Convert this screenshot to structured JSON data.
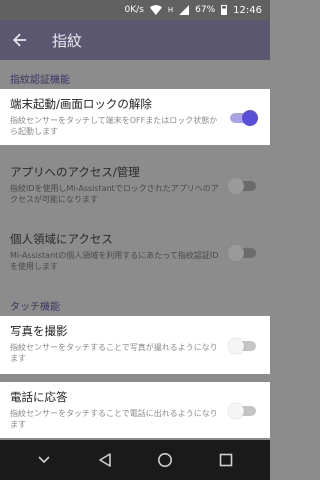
{
  "status_bar": {
    "speed": "0K/s",
    "signal_label": "H",
    "battery": "67%",
    "time": "12:46"
  },
  "app_bar": {
    "title": "指紋"
  },
  "sections": [
    {
      "header": "指紋認証機能"
    },
    {
      "header": "タッチ機能"
    }
  ],
  "items": [
    {
      "title": "端末起動/画面ロックの解除",
      "desc": "指紋センサーをタッチして端末をOFFまたはロック状態から起動します",
      "enabled": true,
      "active": true
    },
    {
      "title": "アプリへのアクセス/管理",
      "desc": "指紋IDを使用しMi-Assistantでロックされたアプリへのアクセスが可能になります",
      "enabled": false,
      "active": false
    },
    {
      "title": "個人領域にアクセス",
      "desc": "Mi-Assistantの個人領域を利用するにあたって指紋認証IDを使用します",
      "enabled": false,
      "active": false
    },
    {
      "title": "写真を撮影",
      "desc": "指紋センサーをタッチすることで写真が撮れるようになります",
      "enabled": false,
      "active": true
    },
    {
      "title": "電話に応答",
      "desc": "指紋センサーをタッチすることで電話に出れるようになります",
      "enabled": false,
      "active": true
    }
  ],
  "colors": {
    "accent": "#5a4fd8",
    "app_bar": "#5b5771",
    "section_header": "#3a3566"
  },
  "icons": {
    "back": "back-arrow-icon",
    "nav": [
      "chevron-down-icon",
      "back-triangle-icon",
      "home-circle-icon",
      "recents-square-icon"
    ]
  }
}
